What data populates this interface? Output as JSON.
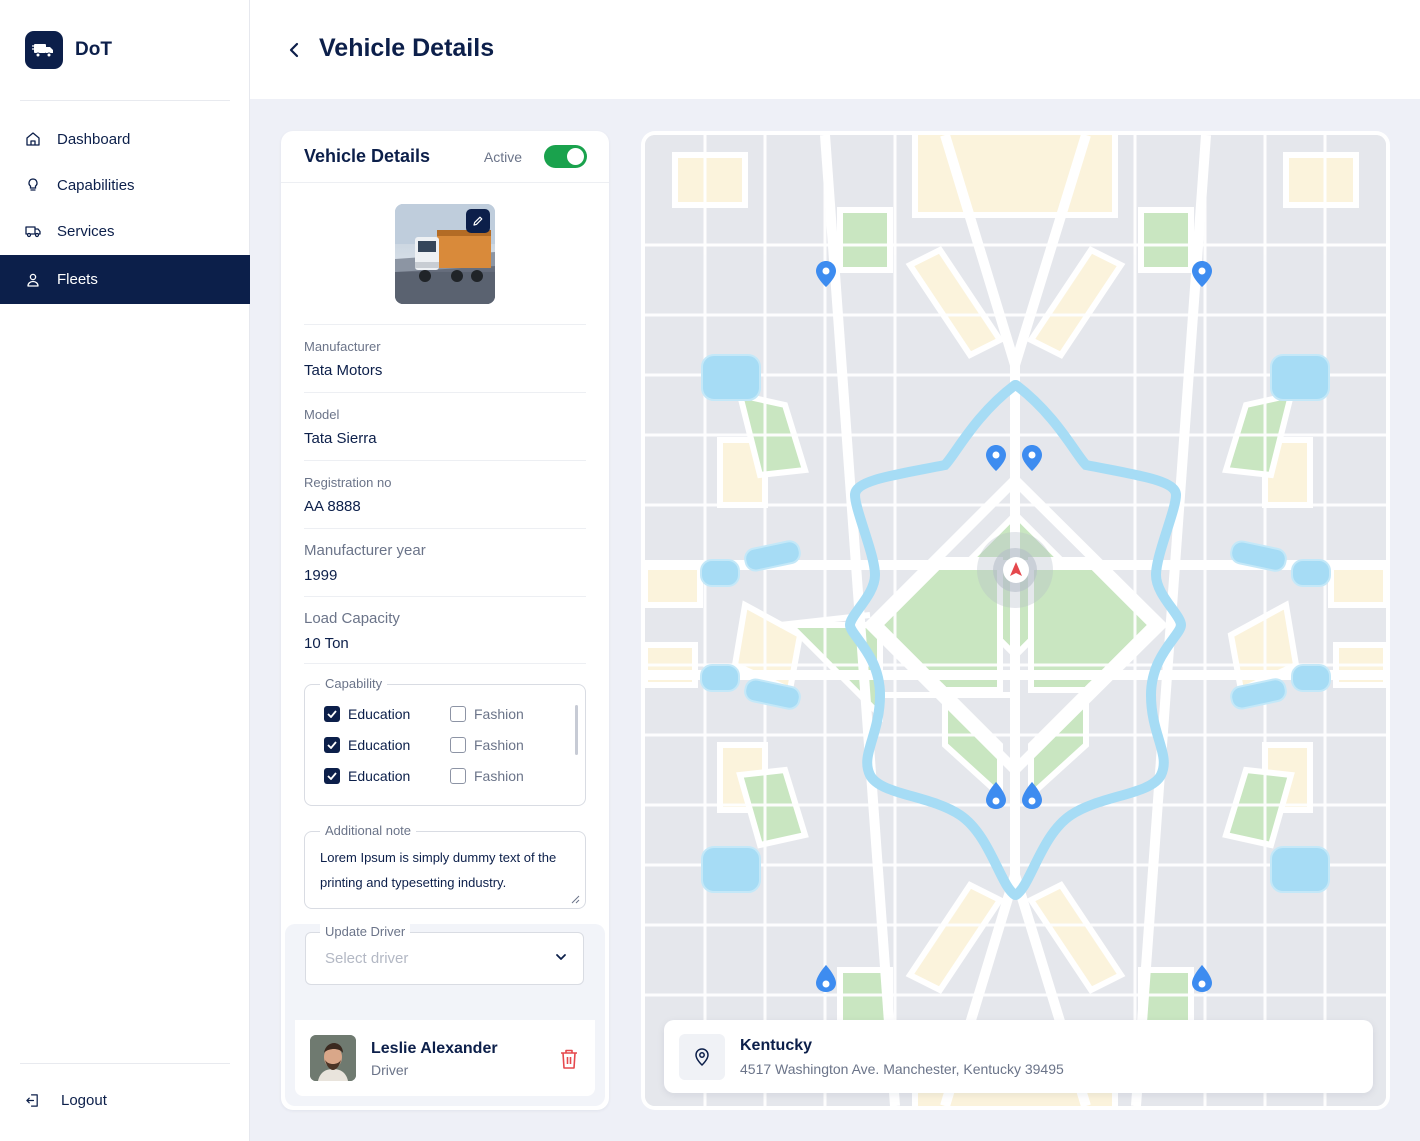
{
  "app": {
    "name": "DoT"
  },
  "sidebar": {
    "items": [
      {
        "label": "Dashboard",
        "icon": "home-icon"
      },
      {
        "label": "Capabilities",
        "icon": "lightbulb-icon"
      },
      {
        "label": "Services",
        "icon": "truck-icon"
      },
      {
        "label": "Fleets",
        "icon": "user-icon",
        "active": true
      }
    ],
    "logout_label": "Logout"
  },
  "header": {
    "title": "Vehicle Details"
  },
  "details": {
    "title": "Vehicle Details",
    "status_label": "Active",
    "active": true,
    "fields": [
      {
        "label": "Manufacturer",
        "value": "Tata Motors"
      },
      {
        "label": "Model",
        "value": "Tata Sierra"
      },
      {
        "label": "Registration no",
        "value": "AA 8888"
      },
      {
        "label": "Manufacturer year",
        "value": "1999"
      },
      {
        "label": "Load Capacity",
        "value": "10 Ton"
      }
    ],
    "capability": {
      "legend": "Capability",
      "options": [
        {
          "label": "Education",
          "checked": true
        },
        {
          "label": "Fashion",
          "checked": false
        },
        {
          "label": "Education",
          "checked": true
        },
        {
          "label": "Fashion",
          "checked": false
        },
        {
          "label": "Education",
          "checked": true
        },
        {
          "label": "Fashion",
          "checked": false
        }
      ]
    },
    "note": {
      "legend": "Additional note",
      "value": "Lorem Ipsum is simply dummy text of the printing and typesetting industry."
    },
    "driver_select": {
      "legend": "Update Driver",
      "placeholder": "Select driver"
    },
    "driver": {
      "name": "Leslie Alexander",
      "role": "Driver"
    }
  },
  "location": {
    "title": "Kentucky",
    "address": "4517 Washington Ave. Manchester, Kentucky 39495"
  },
  "colors": {
    "navy": "#0c1f4a",
    "toggle_on": "#1aa24d",
    "delete": "#e5484d",
    "map_water": "#a6dcf5",
    "map_park": "#c9e6c1",
    "map_block": "#fbf3dc",
    "marker": "#3d8cf0"
  }
}
